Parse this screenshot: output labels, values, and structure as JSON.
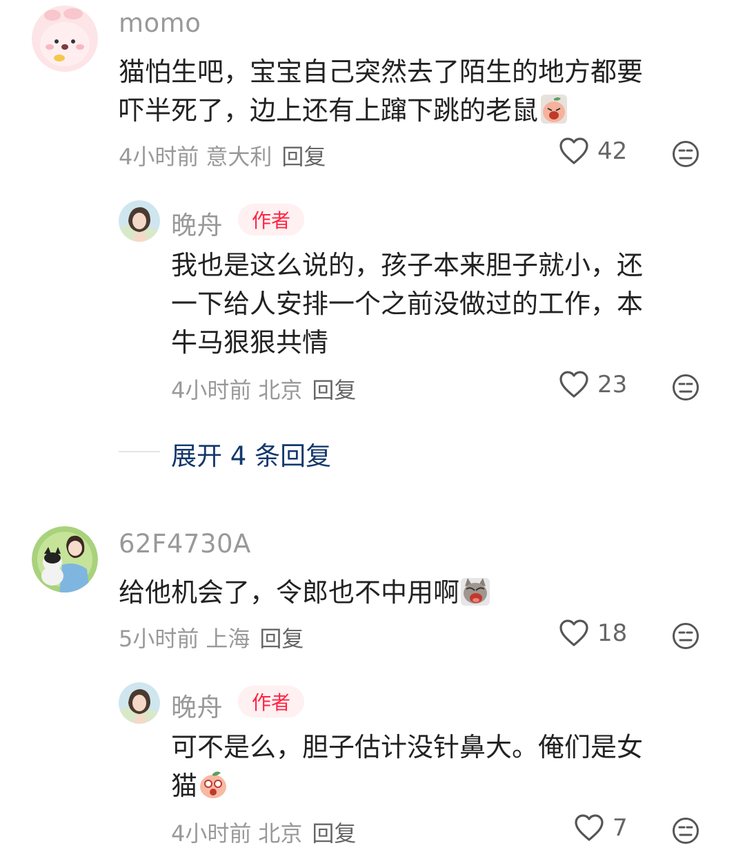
{
  "comments": [
    {
      "username": "momo",
      "text_lines": [
        "猫怕生吧，宝宝自己突然去了陌生的地方都要",
        "吓半死了，边上还有上蹿下跳的老鼠"
      ],
      "time": "4小时前",
      "location": "意大利",
      "reply_label": "回复",
      "likes": "42",
      "avatar_icon": "pink-bunny-avatar",
      "inline_emoji": "crying-peach-emoji",
      "replies": [
        {
          "username": "晚舟",
          "tag": "作者",
          "text_lines": [
            "我也是这么说的，孩子本来胆子就小，还",
            "一下给人安排一个之前没做过的工作，本",
            "牛马狠狠共情"
          ],
          "time": "4小时前",
          "location": "北京",
          "reply_label": "回复",
          "likes": "23",
          "avatar_icon": "girl-portrait-avatar"
        }
      ],
      "expand_label": "展开 4 条回复"
    },
    {
      "username": "62F4730A",
      "text_lines": [
        "给他机会了，令郎也不中用啊"
      ],
      "time": "5小时前",
      "location": "上海",
      "reply_label": "回复",
      "likes": "18",
      "avatar_icon": "girl-with-cat-avatar",
      "inline_emoji": "crying-cat-emoji",
      "replies": [
        {
          "username": "晚舟",
          "tag": "作者",
          "text_lines": [
            "可不是么，胆子估计没针鼻大。俺们是女",
            "猫"
          ],
          "time": "4小时前",
          "location": "北京",
          "reply_label": "回复",
          "likes": "7",
          "avatar_icon": "girl-portrait-avatar",
          "inline_emoji": "shocked-peach-emoji"
        }
      ]
    }
  ],
  "colors": {
    "author_tag_text": "#ff2442",
    "author_tag_bg": "#fff0f1",
    "expand_text": "#13386c",
    "meta_text": "#999999"
  }
}
